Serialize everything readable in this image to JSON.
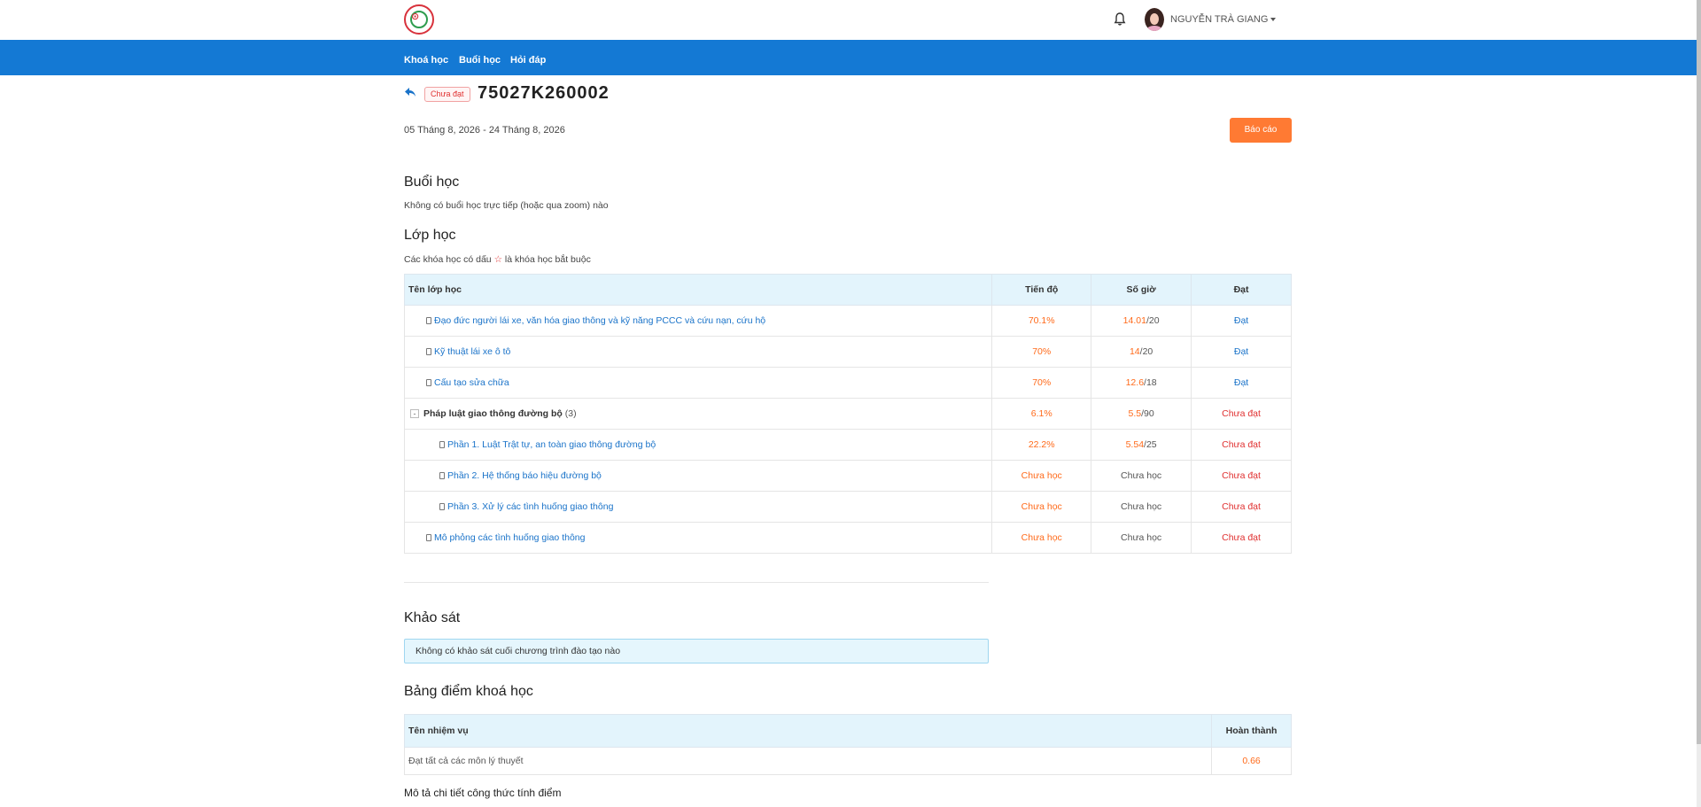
{
  "header": {
    "user_name": "NGUYỄN TRÀ GIANG",
    "logo_icon": "school-logo",
    "bell_icon": "bell-icon"
  },
  "nav": {
    "items": [
      "Khoá học",
      "Buổi học",
      "Hỏi đáp"
    ]
  },
  "course": {
    "status": "Chưa đạt",
    "code": "75027K260002",
    "date_range": "05 Tháng 8, 2026 - 24 Tháng 8, 2026",
    "report_button": "Báo cáo"
  },
  "sessions": {
    "title": "Buổi học",
    "empty_text": "Không có buổi học trực tiếp (hoặc qua zoom) nào"
  },
  "classes": {
    "title": "Lớp học",
    "note_before": "Các khóa học có dấu",
    "note_star": "☆",
    "note_after": "là khóa học bắt buộc",
    "headers": [
      "Tên lớp học",
      "Tiến độ",
      "Số giờ",
      "Đạt"
    ],
    "rows": [
      {
        "name": "Đạo đức người lái xe, văn hóa giao thông và kỹ năng PCCC và cứu nạn, cứu hộ",
        "progress": "70.1%",
        "hours_done": "14.01",
        "hours_total": "/20",
        "hours_text": "",
        "result": "Đạt"
      },
      {
        "name": "Kỹ thuật lái xe ô tô",
        "progress": "70%",
        "hours_done": "14",
        "hours_total": "/20",
        "hours_text": "",
        "result": "Đạt"
      },
      {
        "name": "Cấu tạo sửa chữa",
        "progress": "70%",
        "hours_done": "12.6",
        "hours_total": "/18",
        "hours_text": "",
        "result": "Đạt"
      },
      {
        "name": "Pháp luật giao thông đường bộ",
        "count": "(3)",
        "toggle": "-",
        "progress": "6.1%",
        "hours_done": "5.5",
        "hours_total": "/90",
        "hours_text": "",
        "result": "Chưa đạt"
      },
      {
        "name": "Phần 1. Luật Trật tự, an toàn giao thông đường bộ",
        "progress": "22.2%",
        "hours_done": "5.54",
        "hours_total": "/25",
        "hours_text": "",
        "result": "Chưa đạt"
      },
      {
        "name": "Phần 2. Hệ thống báo hiệu đường bộ",
        "progress": "Chưa học",
        "hours_done": "",
        "hours_total": "",
        "hours_text": "Chưa học",
        "result": "Chưa đạt"
      },
      {
        "name": "Phần 3. Xử lý các tình huống giao thông",
        "progress": "Chưa học",
        "hours_done": "",
        "hours_total": "",
        "hours_text": "Chưa học",
        "result": "Chưa đạt"
      },
      {
        "name": "Mô phỏng các tình huống giao thông",
        "progress": "Chưa học",
        "hours_done": "",
        "hours_total": "",
        "hours_text": "Chưa học",
        "result": "Chưa đạt"
      }
    ]
  },
  "survey": {
    "title": "Khảo sát",
    "empty_text": "Không có khảo sát cuối chương trình đào tạo nào"
  },
  "scores": {
    "title": "Bảng điểm khoá học",
    "headers": [
      "Tên nhiệm vụ",
      "Hoàn thành"
    ],
    "rows": [
      {
        "task": "Đạt tất cả các môn lý thuyết",
        "value": "0.66"
      }
    ]
  },
  "formula_title": "Mô tả chi tiết công thức tính điểm",
  "colors": {
    "nav": "#1479d4",
    "report_button": "#ff7a33",
    "orange": "#ff6a1a",
    "red": "#e03131",
    "link": "#1a73c9"
  }
}
